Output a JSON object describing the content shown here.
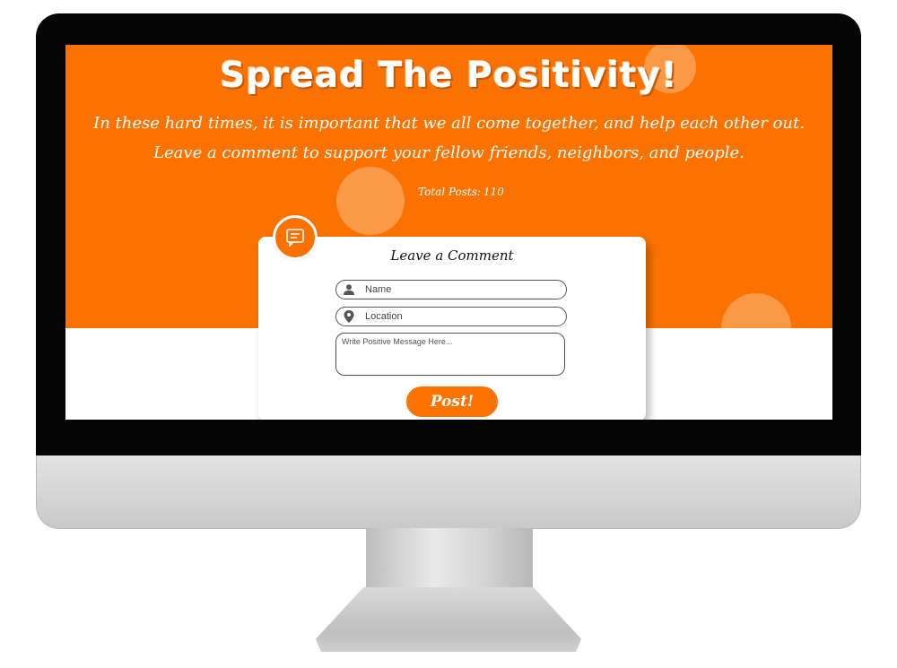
{
  "header": {
    "title": "Spread The Positivity!",
    "subtitle_line1": "In these hard times, it is important that we all come together, and help each other out.",
    "subtitle_line2": "Leave a comment to support your fellow friends, neighbors, and people.",
    "total_posts_label": "Total Posts:",
    "total_posts_count": "110"
  },
  "comment_form": {
    "title": "Leave a Comment",
    "name_placeholder": "Name",
    "location_placeholder": "Location",
    "message_placeholder": "Write Positive Message Here...",
    "submit_label": "Post!",
    "icon": "comment-icon"
  },
  "colors": {
    "accent": "#fb7200",
    "background": "#ffffff"
  }
}
